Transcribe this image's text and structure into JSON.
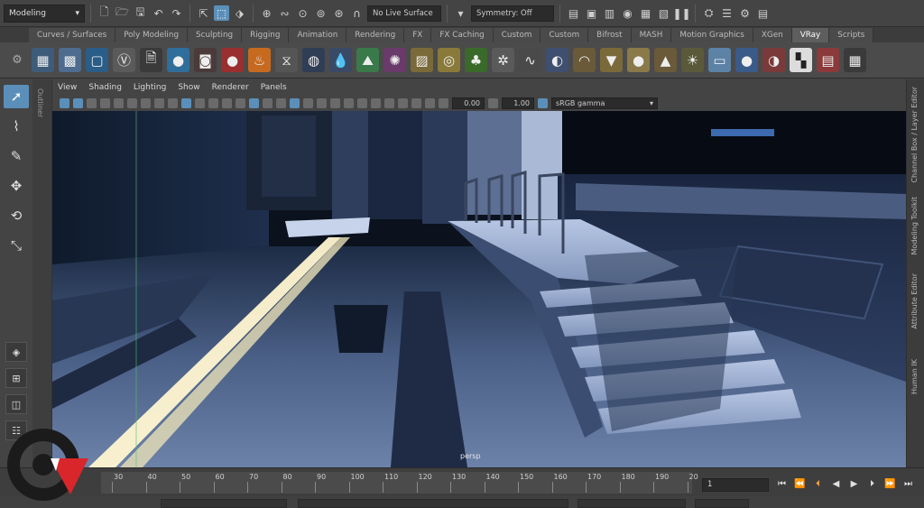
{
  "status_line": {
    "mode": "Modeling",
    "live_surface": "No Live Surface",
    "symmetry": "Symmetry: Off"
  },
  "shelf_tabs": [
    {
      "label": "Curves / Surfaces",
      "active": false
    },
    {
      "label": "Poly Modeling",
      "active": false
    },
    {
      "label": "Sculpting",
      "active": false
    },
    {
      "label": "Rigging",
      "active": false
    },
    {
      "label": "Animation",
      "active": false
    },
    {
      "label": "Rendering",
      "active": false
    },
    {
      "label": "FX",
      "active": false
    },
    {
      "label": "FX Caching",
      "active": false
    },
    {
      "label": "Custom",
      "active": false
    },
    {
      "label": "Custom",
      "active": false
    },
    {
      "label": "Bifrost",
      "active": false
    },
    {
      "label": "MASH",
      "active": false
    },
    {
      "label": "Motion Graphics",
      "active": false
    },
    {
      "label": "XGen",
      "active": false
    },
    {
      "label": "VRay",
      "active": true
    },
    {
      "label": "Scripts",
      "active": false
    }
  ],
  "panel_menu": [
    "View",
    "Shading",
    "Lighting",
    "Show",
    "Renderer",
    "Panels"
  ],
  "panel_toolbar": {
    "value_a": "0.00",
    "value_b": "1.00",
    "color_space": "sRGB gamma"
  },
  "left_strip_label": "Outliner",
  "viewport": {
    "camera": "persp"
  },
  "right_tabs": [
    "Channel Box / Layer Editor",
    "Modeling Toolkit",
    "Attribute Editor",
    "Human IK"
  ],
  "timeline": {
    "ticks": [
      "30",
      "40",
      "50",
      "60",
      "70",
      "80",
      "90",
      "100",
      "110",
      "120",
      "130",
      "140",
      "150",
      "160",
      "170",
      "180",
      "190",
      "20"
    ],
    "current_frame": "1"
  },
  "colors": {
    "accent": "#5b8fb9",
    "panel": "#444444",
    "logo_red": "#d9262a"
  }
}
